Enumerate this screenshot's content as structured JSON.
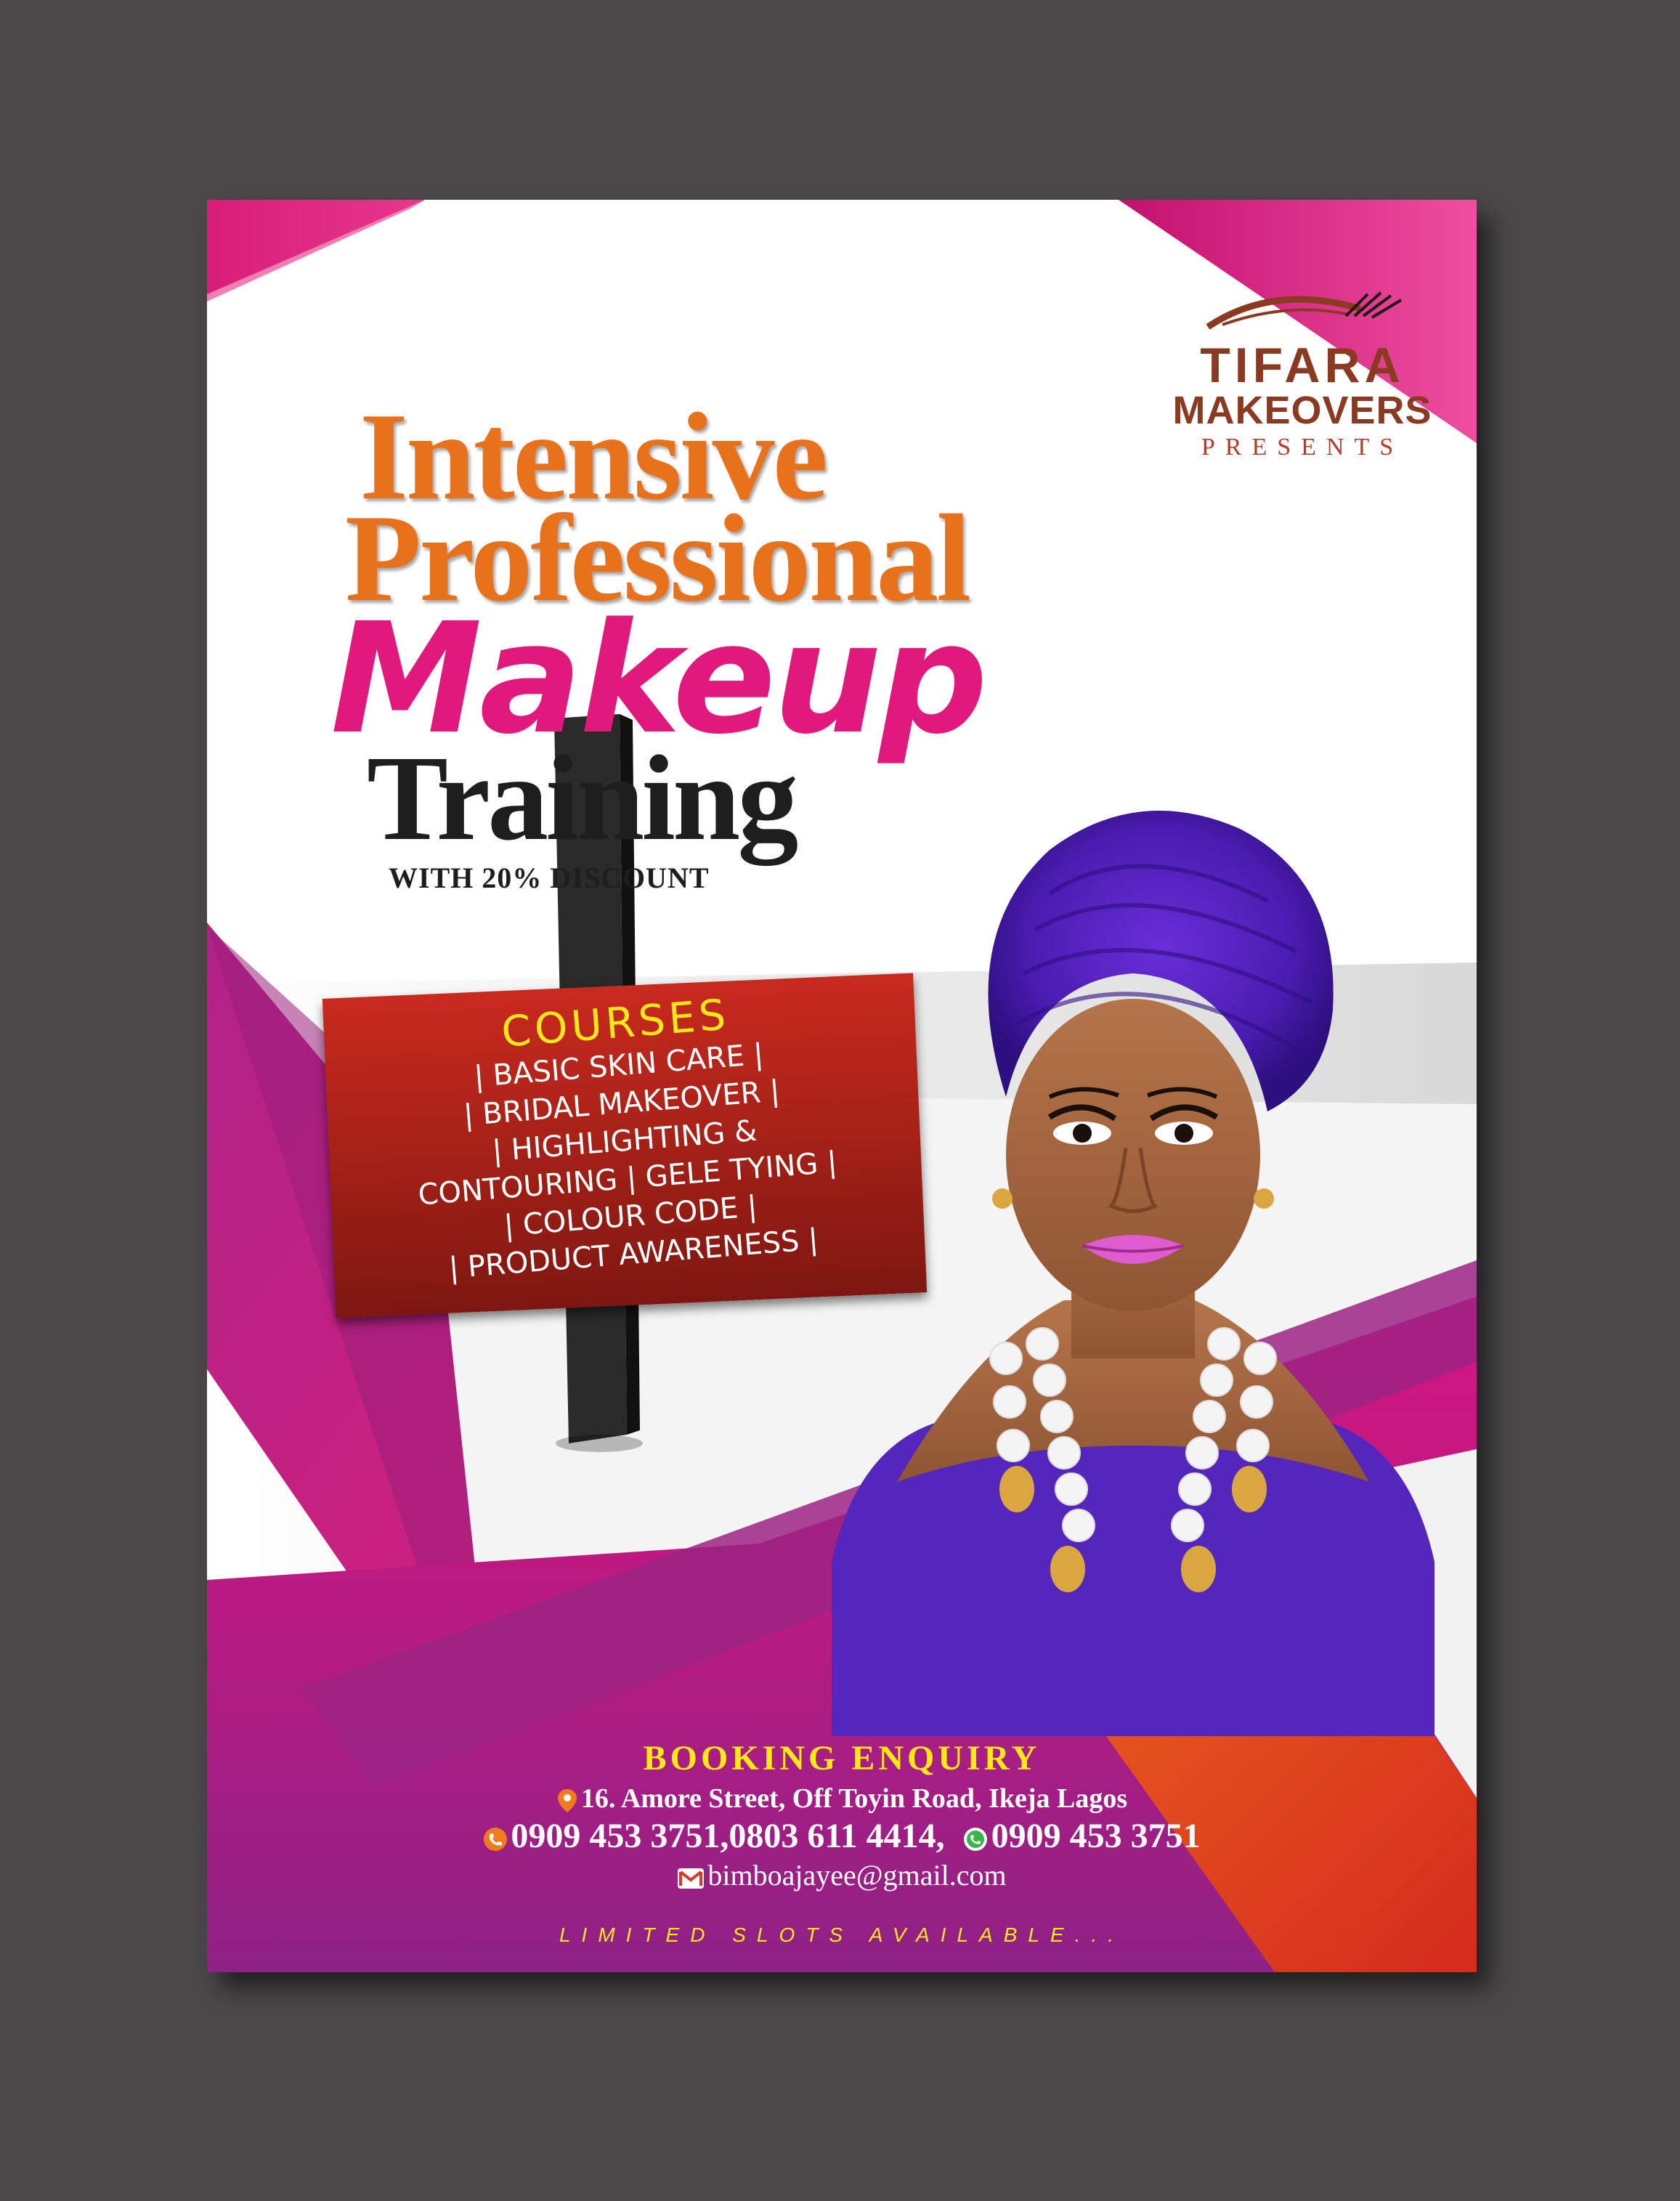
{
  "brand": {
    "name": "TIFARA",
    "name2": "MAKEOVERS",
    "presents": "PRESENTS"
  },
  "headline": {
    "line1": "Intensive",
    "line2": "Professional",
    "line3": "Makeup",
    "line4": "Training",
    "sub": "WITH 20% DISCOUNT"
  },
  "courses": {
    "heading": "COURSES",
    "lines": [
      "| BASIC SKIN CARE |",
      "| BRIDAL MAKEOVER |",
      "| HIGHLIGHTING &",
      "CONTOURING   | GELE TYING |",
      "| COLOUR CODE |",
      "| PRODUCT AWARENESS |"
    ]
  },
  "booking": {
    "heading": "BOOKING ENQUIRY",
    "address": "16. Amore Street, Off Toyin Road, Ikeja Lagos",
    "phones": "0909 453 3751,0803 611 4414,",
    "whatsapp": "0909 453 3751",
    "email": "bimboajayee@gmail.com",
    "limited": "LIMITED SLOTS AVAILABLE..."
  },
  "colors": {
    "magenta": "#e2197d",
    "purple": "#8a1e78",
    "orange": "#e8721c",
    "red": "#d42b1e",
    "gele": "#4a1cb0",
    "background": "#4a4848"
  },
  "icons": [
    "location-pin-icon",
    "phone-icon",
    "whatsapp-icon",
    "gmail-icon"
  ]
}
